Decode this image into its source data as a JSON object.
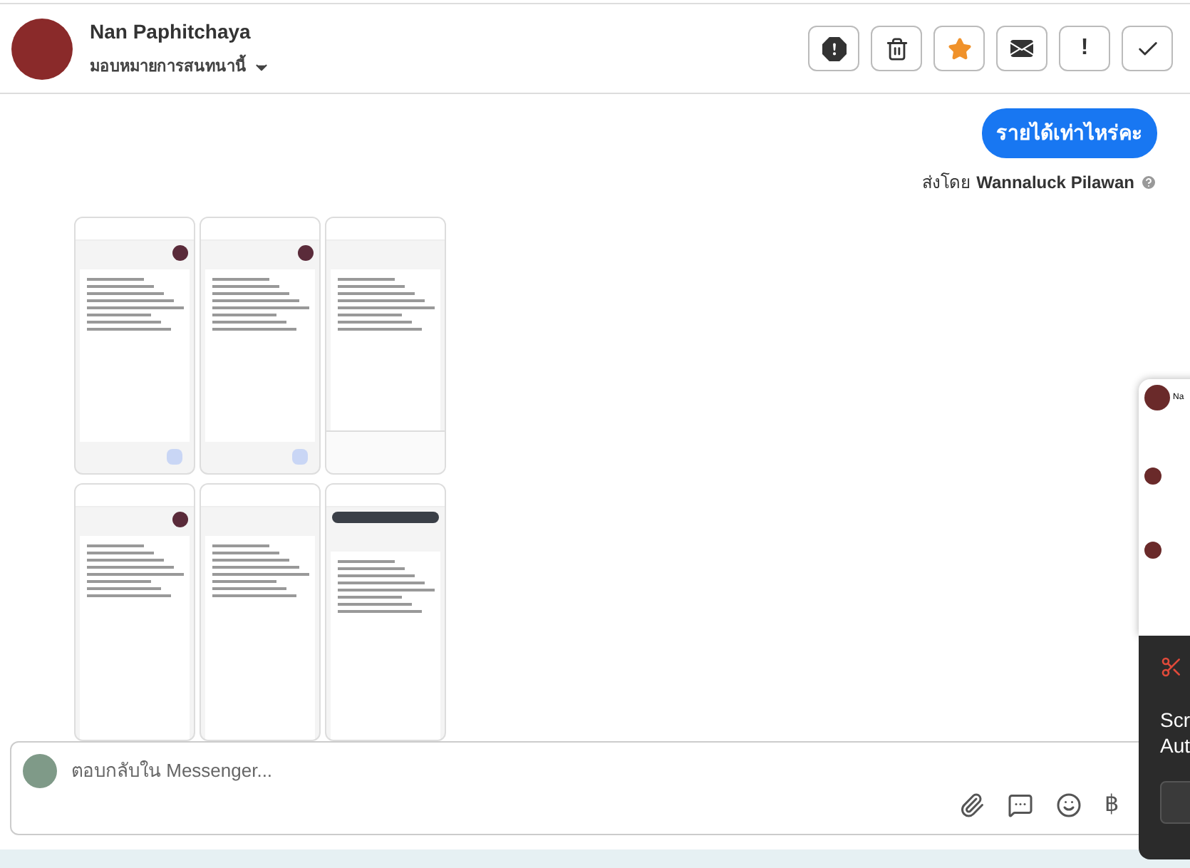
{
  "header": {
    "name": "Nan Paphitchaya",
    "assign_label": "มอบหมายการสนทนานี้",
    "actions": [
      {
        "kind": "report",
        "on": false
      },
      {
        "kind": "delete",
        "on": false
      },
      {
        "kind": "star",
        "on": true
      },
      {
        "kind": "mail",
        "on": false
      },
      {
        "kind": "important",
        "label": "!",
        "on": false
      },
      {
        "kind": "done",
        "on": false
      }
    ]
  },
  "messages": [
    {
      "text": "รายได้เท่าไหร่คะ",
      "sent_by_label": "ส่งโดย",
      "sender": "Wannaluck Pilawan"
    }
  ],
  "attachments": [
    {
      "kind": "chat_view"
    },
    {
      "kind": "chat_view"
    },
    {
      "kind": "keyboard_view"
    },
    {
      "kind": "avatar_view"
    },
    {
      "kind": "plain_view"
    },
    {
      "kind": "banner_view"
    }
  ],
  "composer": {
    "placeholder": "ตอบกลับใน Messenger...",
    "currency_symbol": "฿"
  },
  "chat_popup": {
    "name": "Na"
  },
  "notification": {
    "lines": [
      "Scr",
      "Aut"
    ]
  }
}
